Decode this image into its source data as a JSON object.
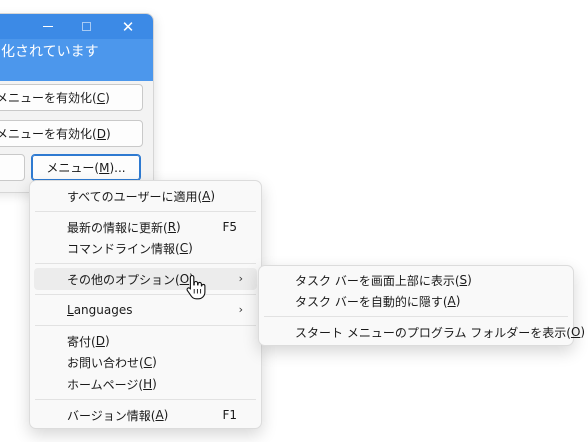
{
  "window": {
    "header_text": "化されています",
    "minimize_label": "–",
    "maximize_label": "□",
    "close_label": "✕",
    "button1": {
      "text": "メニューを有効化(",
      "key": "C",
      "close": ")"
    },
    "button2": {
      "text": "メニューを有効化(",
      "key": "D",
      "close": ")"
    },
    "menu_button": {
      "text": "メニュー(",
      "key": "M",
      "close": ")..."
    }
  },
  "context_menu": {
    "items": [
      {
        "text": "すべてのユーザーに適用(",
        "key": "A",
        "close": ")",
        "accel": ""
      },
      {
        "text": "最新の情報に更新(",
        "key": "R",
        "close": ")",
        "accel": "F5"
      },
      {
        "text": "コマンドライン情報(",
        "key": "C",
        "close": ")",
        "accel": ""
      },
      {
        "text": "その他のオプション(",
        "key": "O",
        "close": ")",
        "accel": "",
        "arrow": "›"
      },
      {
        "text": "",
        "key": "L",
        "close": "anguages",
        "accel": "",
        "arrow": "›"
      },
      {
        "text": "寄付(",
        "key": "D",
        "close": ")",
        "accel": ""
      },
      {
        "text": "お問い合わせ(",
        "key": "C",
        "close": ")",
        "accel": ""
      },
      {
        "text": "ホームページ(",
        "key": "H",
        "close": ")",
        "accel": ""
      },
      {
        "text": "バージョン情報(",
        "key": "A",
        "close": ")",
        "accel": "F1"
      }
    ]
  },
  "submenu": {
    "items": [
      {
        "text": "タスク バーを画面上部に表示(",
        "key": "S",
        "close": ")"
      },
      {
        "text": "タスク バーを自動的に隠す(",
        "key": "A",
        "close": ")"
      },
      {
        "text": "スタート メニューのプログラム フォルダーを表示(",
        "key": "O",
        "close": ")"
      }
    ]
  },
  "cursor": {
    "icon": "hand-pointer-icon"
  },
  "colors": {
    "title_bar": "#3c8ae6",
    "header": "#4c97ec",
    "menu_bg": "#f9f9f9",
    "hover": "#ececec"
  }
}
